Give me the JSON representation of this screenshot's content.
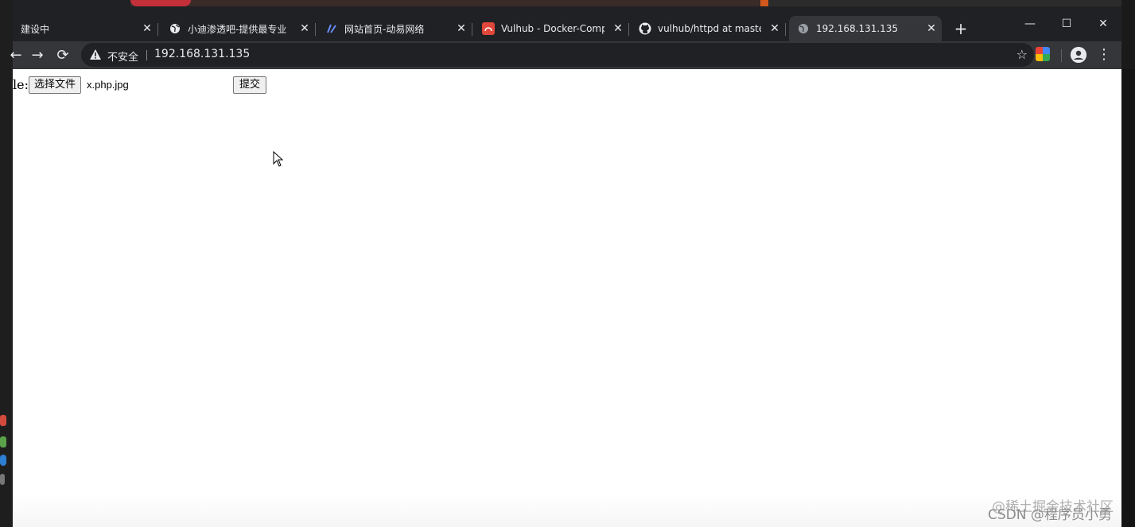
{
  "tabs": [
    {
      "label": "建设中",
      "favicon": "none"
    },
    {
      "label": "小迪渗透吧-提供最专业",
      "favicon": "globe-icon"
    },
    {
      "label": "网站首页-动易网络",
      "favicon": "site-icon"
    },
    {
      "label": "Vulhub - Docker-Comp",
      "favicon": "vulhub-icon"
    },
    {
      "label": "vulhub/httpd at maste",
      "favicon": "github-icon"
    },
    {
      "label": "192.168.131.135",
      "favicon": "globe-icon",
      "active": true
    }
  ],
  "address_bar": {
    "security_label": "不安全",
    "url": "192.168.131.135"
  },
  "form": {
    "label": "le:",
    "choose_file_label": "选择文件",
    "file_name": "x.php.jpg",
    "submit_label": "提交"
  },
  "watermark": {
    "line1": "@稀土掘金技术社区",
    "line2": "CSDN @程序员小勇"
  },
  "colors": {
    "tab_strip": "#202124",
    "toolbar": "#35363a",
    "active_tab": "#35363a",
    "text_light": "#e8eaed",
    "page": "#ffffff"
  }
}
